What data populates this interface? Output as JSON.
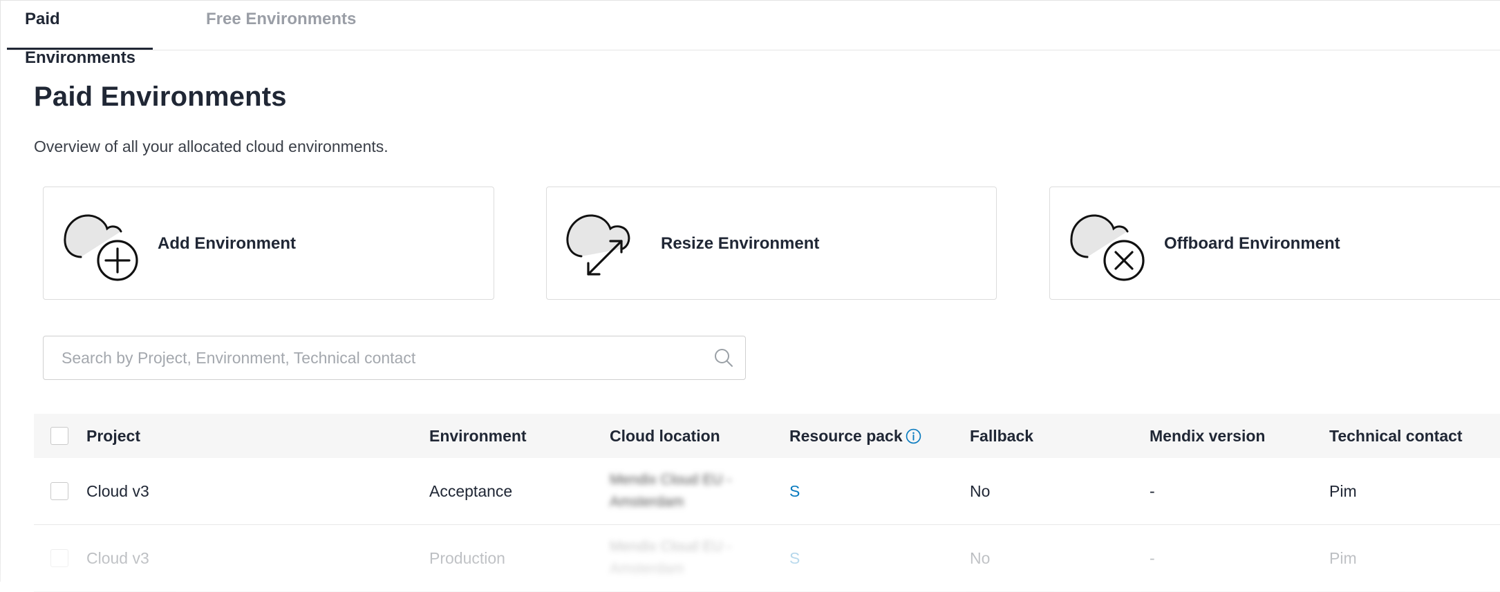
{
  "tabs": [
    {
      "label": "Paid Environments",
      "active": true
    },
    {
      "label": "Free Environments",
      "active": false
    }
  ],
  "header": {
    "title": "Paid Environments",
    "subtitle": "Overview of all your allocated cloud environments."
  },
  "actions": [
    {
      "label": "Add Environment",
      "icon": "cloud-add-icon"
    },
    {
      "label": "Resize Environment",
      "icon": "cloud-resize-icon"
    },
    {
      "label": "Offboard Environment",
      "icon": "cloud-remove-icon"
    }
  ],
  "search": {
    "placeholder": "Search by Project, Environment, Technical contact",
    "value": ""
  },
  "table": {
    "columns": [
      "Project",
      "Environment",
      "Cloud location",
      "Resource pack",
      "Fallback",
      "Mendix version",
      "Technical contact"
    ],
    "resource_pack_info_icon": "info-icon",
    "rows": [
      {
        "project": "Cloud v3",
        "environment": "Acceptance",
        "cloud_location": [
          "Mendix Cloud EU -",
          "Amsterdam"
        ],
        "resource_pack": "S",
        "fallback": "No",
        "mendix_version": "-",
        "technical_contact": "Pim"
      },
      {
        "project": "Cloud v3",
        "environment": "Production",
        "cloud_location": [
          "Mendix Cloud EU -",
          "Amsterdam"
        ],
        "resource_pack": "S",
        "fallback": "No",
        "mendix_version": "-",
        "technical_contact": "Pim"
      }
    ]
  },
  "colors": {
    "text": "#202735",
    "muted": "#9a9ea6",
    "link": "#0a7bbf",
    "header_bg": "#f6f6f6",
    "border": "#dcdcdc"
  }
}
